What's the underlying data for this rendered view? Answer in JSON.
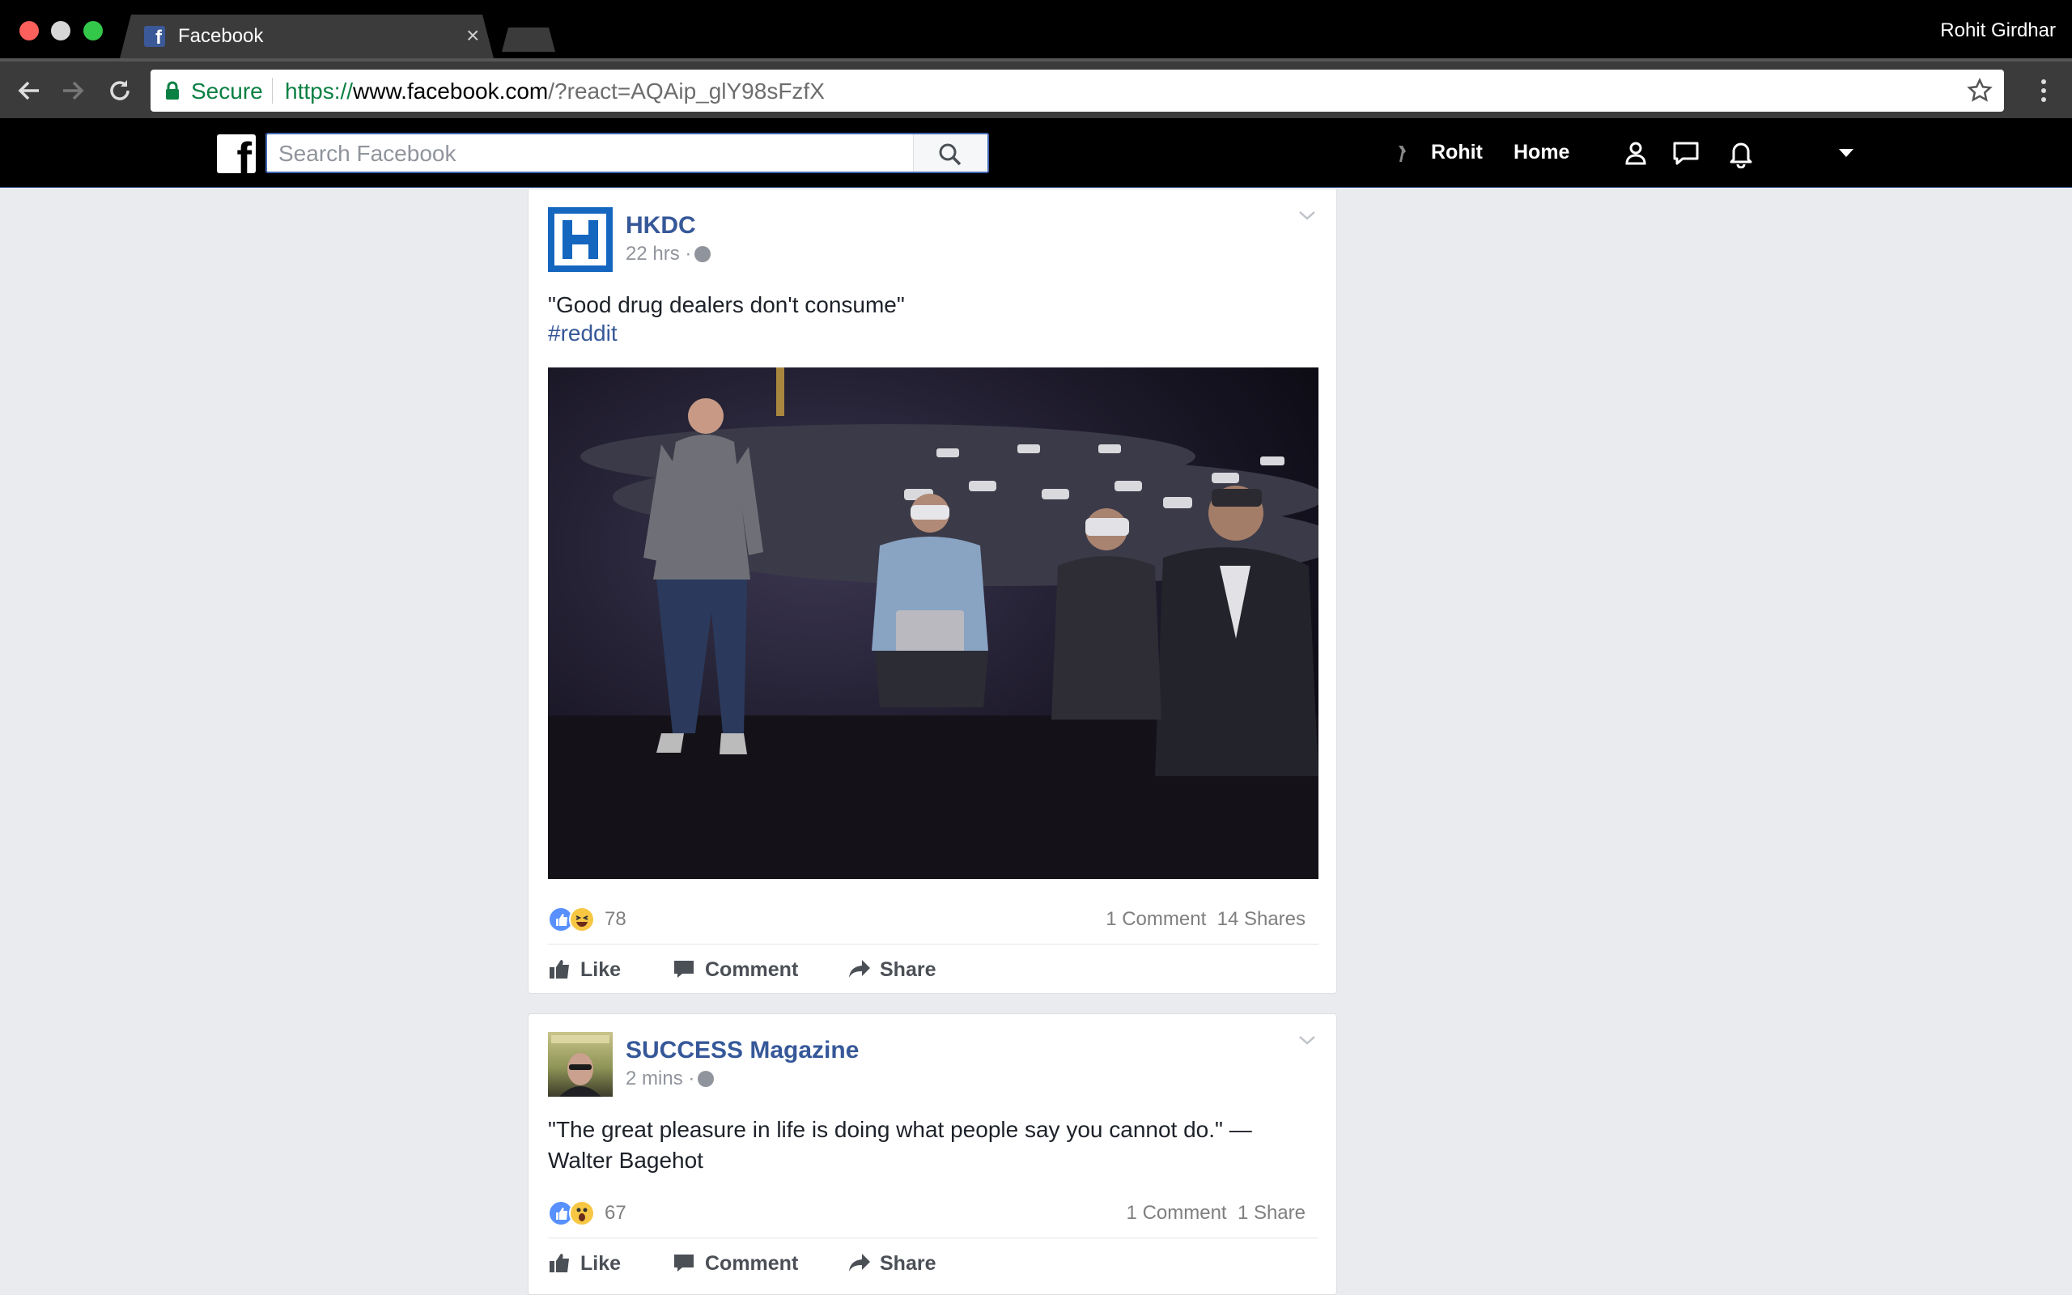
{
  "browser": {
    "tab_title": "Facebook",
    "tab_close": "×",
    "profile_name": "Rohit Girdhar",
    "secure_label": "Secure",
    "url_scheme": "https://",
    "url_host": "www.facebook.com",
    "url_rest": "/?react=AQAip_glY98sFzfX"
  },
  "fbbar": {
    "logo": "f",
    "search_placeholder": "Search Facebook",
    "user_name": "Rohit",
    "home_label": "Home"
  },
  "posts": [
    {
      "page_name": "HKDC",
      "time": "22 hrs ·",
      "text": "\"Good drug dealers don't consume\"",
      "hashtag": "#reddit",
      "reaction_count": "78",
      "comments": "1 Comment",
      "shares": "14 Shares",
      "actions": {
        "like": "Like",
        "comment": "Comment",
        "share": "Share"
      }
    },
    {
      "page_name": "SUCCESS Magazine",
      "time": "2 mins ·",
      "text": "\"The great pleasure in life is doing what people say you cannot do.\" — Walter Bagehot",
      "reaction_count": "67",
      "comments": "1 Comment",
      "shares": "1 Share",
      "actions": {
        "like": "Like",
        "comment": "Comment",
        "share": "Share"
      }
    }
  ],
  "colors": {
    "facebook_blue": "#365899",
    "secure_green": "#0b8043",
    "like_blue": "#5890ff",
    "reaction_yellow": "#f7c744"
  }
}
